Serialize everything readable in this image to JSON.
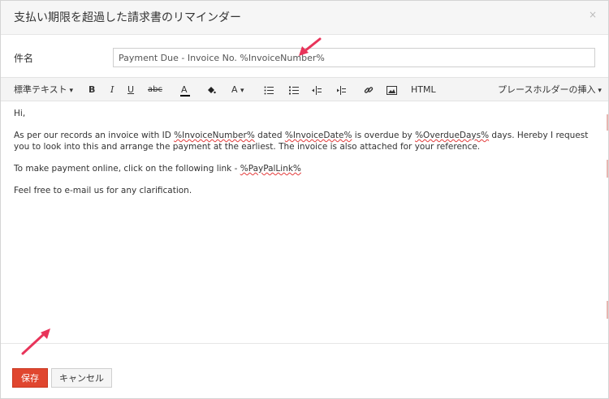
{
  "dialog": {
    "title": "支払い期限を超過した請求書のリマインダー",
    "close_glyph": "×"
  },
  "subject": {
    "label": "件名",
    "value": "Payment Due - Invoice No. %InvoiceNumber%"
  },
  "toolbar": {
    "format_label": "標準テキスト",
    "bold": "B",
    "italic": "I",
    "underline": "U",
    "strike": "abc",
    "font_color": "A",
    "font_size": "A",
    "html": "HTML",
    "placeholder_label": "プレースホルダーの挿入",
    "icons": [
      "paint-bucket-icon",
      "bullet-list-icon",
      "numbered-list-icon",
      "indent-icon",
      "outdent-icon",
      "link-icon",
      "image-icon"
    ]
  },
  "editor": {
    "greeting": "Hi,",
    "p1_a": "As per our records an invoice with ID ",
    "p1_var1": "%InvoiceNumber%",
    "p1_b": " dated ",
    "p1_var2": "%InvoiceDate%",
    "p1_c": " is overdue by ",
    "p1_var3": "%OverdueDays%",
    "p1_d": " days. Hereby I request you to look into this and arrange the payment at the earliest. The invoice is also attached for your reference.",
    "p2_a": "To make payment online, click on the following link - ",
    "p2_var": "%PayPalLink%",
    "p3": "Feel free to e-mail us for any clarification."
  },
  "footer": {
    "save_label": "保存",
    "cancel_label": "キャンセル"
  },
  "colors": {
    "accent": "#e0462f",
    "annotation_arrow": "#e8345a"
  }
}
